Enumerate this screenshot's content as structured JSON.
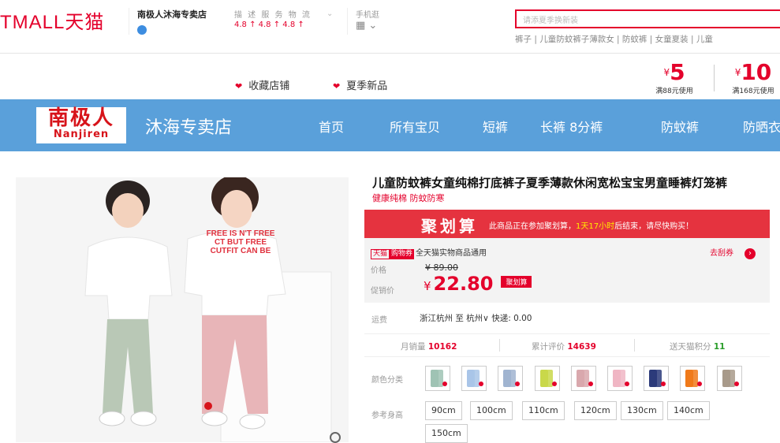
{
  "header": {
    "logo": "TMALL天猫",
    "shop_name": "南极人沐海专卖店",
    "rating_labels": "描 述   服 务   物 流",
    "rating_values": "4.8 ↑  4.8 ↑  4.8 ↑",
    "mobile_label": "手机逛",
    "search_placeholder": "请添夏季换新装",
    "hot_words": "裤子 | 儿童防蚊裤子薄款女 | 防蚊裤 | 女童夏装 | 儿童"
  },
  "favbar": {
    "collect_label": "收藏店铺",
    "new_label": "夏季新品",
    "coupons": [
      {
        "symbol": "¥",
        "amount": "5",
        "condition": "满88元使用"
      },
      {
        "symbol": "¥",
        "amount": "10",
        "condition": "满168元使用"
      }
    ]
  },
  "nav": {
    "brand_cn": "南极人",
    "brand_en": "Nanjiren",
    "store_name": "沐海专卖店",
    "items": [
      "首页",
      "所有宝贝",
      "短裤",
      "长裤 8分裤",
      "防蚊裤",
      "防晒衣"
    ]
  },
  "gallery": {
    "shirt_text": "FREE IS N'T FREE CT BUT FREE CUTFIT CAN BE"
  },
  "product": {
    "title": "儿童防蚊裤女童纯棉打底裤子夏季薄款休闲宽松宝宝男童睡裤灯笼裤",
    "subtitle": "健康纯棉 防蚊防寒",
    "jhs_logo": "聚划算",
    "jhs_note_prefix": "此商品正在参加聚划算，",
    "jhs_note_time": "1天17小时",
    "jhs_note_suffix": "后结束，请尽快购买！",
    "tmall_tag": "天猫",
    "coupon_tag": "购物券",
    "coupon_text": "全天猫实物商品通用",
    "get_coupon": "去刮券",
    "price_label": "价格",
    "price_original": "¥ 89.00",
    "promo_label": "促销价",
    "currency": "¥",
    "promo_price": "22.80",
    "promo_tag": "聚划算",
    "shipping_label": "运费",
    "shipping_value": "浙江杭州 至 杭州∨ 快递: 0.00",
    "stats": [
      {
        "label": "月销量",
        "value": "10162"
      },
      {
        "label": "累计评价",
        "value": "14639"
      },
      {
        "label": "送天猫积分",
        "value": "11"
      }
    ],
    "color_label": "颜色分类",
    "colors": [
      "#9fc3b4",
      "#a9c5e8",
      "#a0b4d0",
      "#c9d84a",
      "#d9a8ad",
      "#f0b6c4",
      "#2c3b7a",
      "#f07a1a",
      "#a89a8a"
    ],
    "size_label": "参考身高",
    "sizes": [
      "90cm",
      "100cm",
      "110cm",
      "120cm",
      "130cm",
      "140cm",
      "150cm"
    ]
  }
}
